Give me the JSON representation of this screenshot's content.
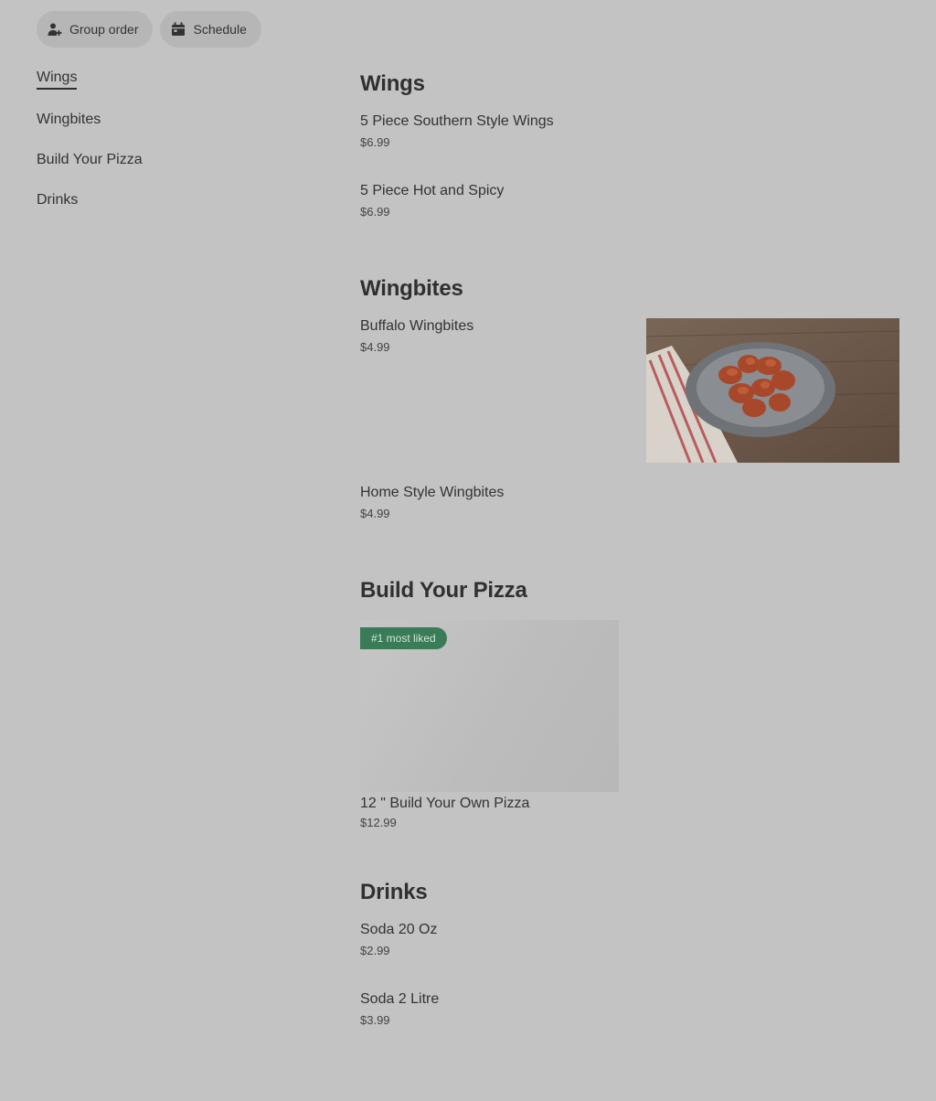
{
  "toolbar": {
    "group_order_label": "Group order",
    "schedule_label": "Schedule"
  },
  "sidebar": {
    "items": [
      {
        "label": "Wings"
      },
      {
        "label": "Wingbites"
      },
      {
        "label": "Build Your Pizza"
      },
      {
        "label": "Drinks"
      }
    ]
  },
  "sections": [
    {
      "title": "Wings",
      "items": [
        {
          "name": "5 Piece Southern Style Wings",
          "price": "$6.99"
        },
        {
          "name": "5 Piece Hot and Spicy",
          "price": "$6.99"
        }
      ]
    },
    {
      "title": "Wingbites",
      "items": [
        {
          "name": "Buffalo Wingbites",
          "price": "$4.99"
        },
        {
          "name": "Home Style Wingbites",
          "price": "$4.99"
        }
      ]
    },
    {
      "title": "Build Your Pizza",
      "badge": "#1 most liked",
      "items": [
        {
          "name": "12 \" Build Your Own Pizza",
          "price": "$12.99"
        }
      ]
    },
    {
      "title": "Drinks",
      "items": [
        {
          "name": "Soda 20 Oz",
          "price": "$2.99"
        },
        {
          "name": "Soda 2 Litre",
          "price": "$3.99"
        }
      ]
    }
  ],
  "colors": {
    "background": "#c3c3c3",
    "pill": "#b6b6b6",
    "badge": "#3a7b58",
    "text": "#2f2f2f"
  }
}
